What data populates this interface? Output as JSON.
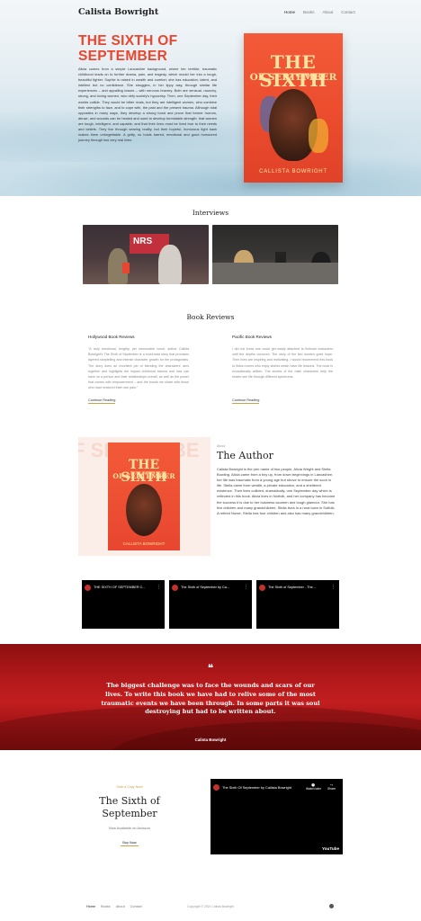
{
  "header": {
    "brand": "Calista Bowright",
    "nav": [
      "Home",
      "Books",
      "About",
      "Contact"
    ]
  },
  "hero": {
    "title": "THE SIXTH OF SEPTEMBER",
    "text": "Alicia comes from a simple Lancashire background, where her terrible, traumatic childhood leads on to further drama, pain, and tragedy, which mould her into a tough, beautiful fighter. Sophie is raised in wealth and comfort; she has education, talent, and intellect but no confidence. She struggles, in her lippy way, through similar life experiences – and appalling losses – with nervous bravery. Both are sensual, raunchy, strong, and loving women, who defy society's hypocrisy. Then, one September day, their worlds collide. They would be bitter rivals, but they are intelligent women, who combine their strengths to face, and to cope with, the past and the present trauma. Although total opposites in many ways, they develop a strong bond and prove that former horrors, abuse, and wounds can be healed and used to develop formidable strength: that women are tough, intelligent, and capable; and that their lives must be lived true to their needs and beliefs. They live through searing reality, but their hopeful, humorous fight back makes them unforgettable. A gritty, no holds barred, emotional and good humoured journey through two very real lives.",
    "book": {
      "title_line1": "THE SIXTH",
      "title_line2": "OF SEPTEMBER",
      "author": "CALLISTA BOWRIGHT"
    }
  },
  "interviews": {
    "title": "Interviews",
    "sign_text": "NRS"
  },
  "reviews": {
    "title": "Book Reviews",
    "items": [
      {
        "source": "Hollywood Book Reviews",
        "text": "\"A truly emotional, lengthy, yet memorable novel, author Calista Bowright's The Sixth of September is a must-read story that promises layered storytelling and intense character growth for the protagonists. The story does an excellent job of blending the characters' arcs together and highlights the impact childhood trauma and loss can have on a person and their relationships overall, as well as the power that comes with empowerment – and the bonds we share with those who have endured their own pain.\"",
        "link": "Continue Reading"
      },
      {
        "source": "Pacific Book Reviews",
        "text": "I did not know one could get easily attached to fictional characters until the depths occurred. The story of the two women goes hope. Their lives are inspiring and motivating. I would recommend this book to fiction lovers who enjoy stories which have life lessons. The book is exceptionally written. The stories of the main characters help the reader see life through different spectrums.",
        "link": "Continue Reading"
      }
    ]
  },
  "about": {
    "bg_text": "F SEPTEMBE",
    "small": "About",
    "title": "The Author",
    "text": "Calista Bowright is the pen name of two people, Alicia Wright and Stella Bowling. Alicia came from a tiny up, from down beginnings in Lancashire, her life was traumatic from a young age but strove to ensure the soon in life. Stella came from wealth, a private education, and a sheltered existence. Their lives collided, dramatically, one September day which is reflected in this book. Alicia lives in Norfolk, and her company has become the success it is due to her business acumen and tough glamour. She has five children and many grandchildren. Stella lives in a rural town in Suffolk. A retired Nurse, Stella has four children and also has many grandchildren.",
    "book": {
      "title_line1": "THE SIXTH",
      "title_line2": "OF SEPTEMBER",
      "author": "CALLISTA BOWRIGHT"
    }
  },
  "videos": [
    {
      "title": "THE SIXTH OF SEPTEMBER C..."
    },
    {
      "title": "The Sixth of September by Ca..."
    },
    {
      "title": "The Sixth of September - The..."
    }
  ],
  "quote": {
    "mark": "❝",
    "text": "The biggest challenge was to face the wounds and scars of our lives. To write this book we have had to relive some of the most traumatic events we have been through. In some parts it was soul destroying but had to be written about.",
    "author": "Calista Bowright"
  },
  "buy": {
    "small": "Grab a Copy Now!",
    "title": "The Sixth of September",
    "sub": "Now Available on Amazon",
    "button": "Buy Now",
    "video": {
      "title": "The Sixth Of September by Callista Bowright",
      "watch_later": "Watch later",
      "share": "Share",
      "brand": "YouTube"
    }
  },
  "footer": {
    "nav": [
      "Home",
      "Books",
      "About",
      "Contact"
    ],
    "copyright": "Copyright © 2021 Calista Bowright"
  },
  "colors": {
    "accent": "#e8462f",
    "quote_red": "#b0181a",
    "gold": "#c9a24c"
  }
}
